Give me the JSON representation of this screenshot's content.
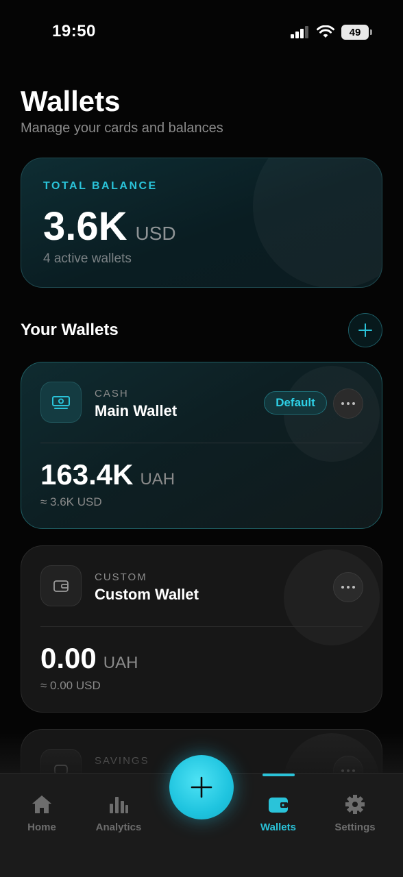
{
  "status_bar": {
    "time": "19:50",
    "battery": "49"
  },
  "header": {
    "title": "Wallets",
    "subtitle": "Manage your cards and balances"
  },
  "total_balance": {
    "label": "TOTAL BALANCE",
    "amount": "3.6K",
    "currency": "USD",
    "subtitle": "4 active wallets"
  },
  "wallets_section": {
    "title": "Your Wallets"
  },
  "wallets": [
    {
      "type": "CASH",
      "name": "Main Wallet",
      "badge": "Default",
      "amount": "163.4K",
      "currency": "UAH",
      "converted": "≈ 3.6K USD",
      "icon": "cash-icon",
      "accent": "#2ac3d9"
    },
    {
      "type": "CUSTOM",
      "name": "Custom Wallet",
      "amount": "0.00",
      "currency": "UAH",
      "converted": "≈ 0.00 USD",
      "icon": "wallet-icon"
    },
    {
      "type": "SAVINGS",
      "icon": "savings-icon"
    }
  ],
  "tab_bar": {
    "items": [
      {
        "label": "Home",
        "icon": "home-icon"
      },
      {
        "label": "Analytics",
        "icon": "bar-chart-icon"
      },
      {
        "label": "Wallets",
        "icon": "wallet-icon",
        "active": true
      },
      {
        "label": "Settings",
        "icon": "gear-icon"
      }
    ],
    "fab_icon": "plus-icon"
  },
  "colors": {
    "accent": "#2ac3d9",
    "background": "#050505",
    "card": "#171717"
  }
}
